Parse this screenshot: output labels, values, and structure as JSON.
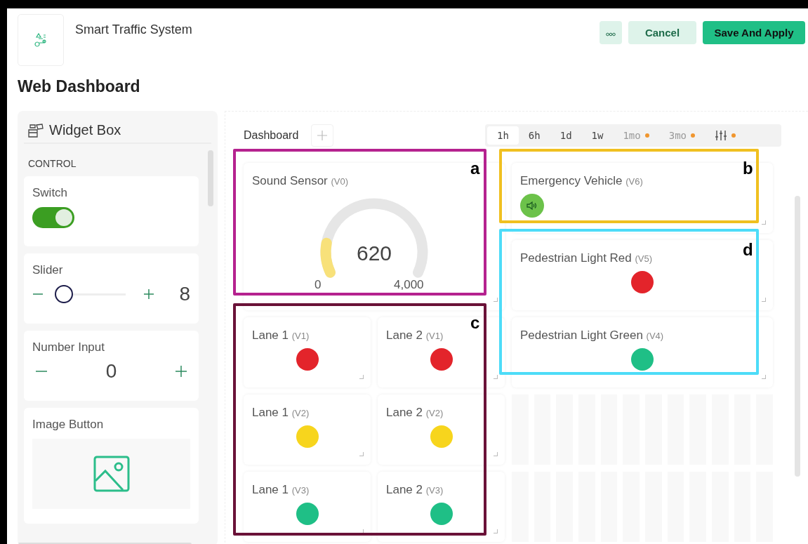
{
  "app": {
    "title": "Smart Traffic System"
  },
  "header_buttons": [
    {
      "kind": "more"
    },
    {
      "kind": "secondary",
      "label": "Cancel"
    },
    {
      "kind": "primary",
      "label": "Save And Apply"
    }
  ],
  "page_title": "Web Dashboard",
  "widget_box": {
    "title": "Widget Box",
    "section": "CONTROL",
    "items": [
      {
        "kind": "switch",
        "label": "Switch",
        "on": true
      },
      {
        "kind": "slider",
        "label": "Slider",
        "level": 0.1,
        "value": "8"
      },
      {
        "kind": "number",
        "label": "Number Input",
        "value": "0"
      },
      {
        "kind": "image",
        "label": "Image Button"
      }
    ]
  },
  "dashboard": {
    "tab": "Dashboard",
    "time_ranges": [
      {
        "label": "1h",
        "selected": true,
        "dot": false
      },
      {
        "label": "6h",
        "selected": false,
        "dot": false
      },
      {
        "label": "1d",
        "selected": false,
        "dot": false
      },
      {
        "label": "1w",
        "selected": false,
        "dot": false
      },
      {
        "label": "1mo",
        "selected": false,
        "dot": true
      },
      {
        "label": "3mo",
        "selected": false,
        "dot": true
      }
    ],
    "filter": {
      "dot": true
    },
    "widgets": [
      {
        "kind": "gauge",
        "name": "Sound Sensor",
        "pin": "(V0)",
        "value": "620",
        "min": "0",
        "max": "4,000"
      },
      {
        "kind": "sound",
        "name": "Emergency Vehicle",
        "pin": "(V6)",
        "on": true
      },
      {
        "kind": "led",
        "name": "Pedestrian Light Red",
        "pin": "(V5)",
        "color": "#e3242b"
      },
      {
        "kind": "led",
        "name": "Lane 1",
        "pin": "(V1)",
        "color": "#e3242b"
      },
      {
        "kind": "led",
        "name": "Lane 2",
        "pin": "(V1)",
        "color": "#e3242b"
      },
      {
        "kind": "led",
        "name": "Pedestrian Light Green",
        "pin": "(V4)",
        "color": "#1fbf86"
      },
      {
        "kind": "led",
        "name": "Lane 1",
        "pin": "(V2)",
        "color": "#f7d51d"
      },
      {
        "kind": "led",
        "name": "Lane 2",
        "pin": "(V2)",
        "color": "#f7d51d"
      },
      {
        "kind": "led",
        "name": "Lane 1",
        "pin": "(V3)",
        "color": "#1fbf86"
      },
      {
        "kind": "led",
        "name": "Lane 2",
        "pin": "(V3)",
        "color": "#1fbf86"
      }
    ]
  },
  "annotations": [
    {
      "label": "a",
      "color": "#b5228f"
    },
    {
      "label": "b",
      "color": "#f0c020"
    },
    {
      "label": "d",
      "color": "#4ddcf8"
    },
    {
      "label": "c",
      "color": "#6a1238"
    }
  ]
}
